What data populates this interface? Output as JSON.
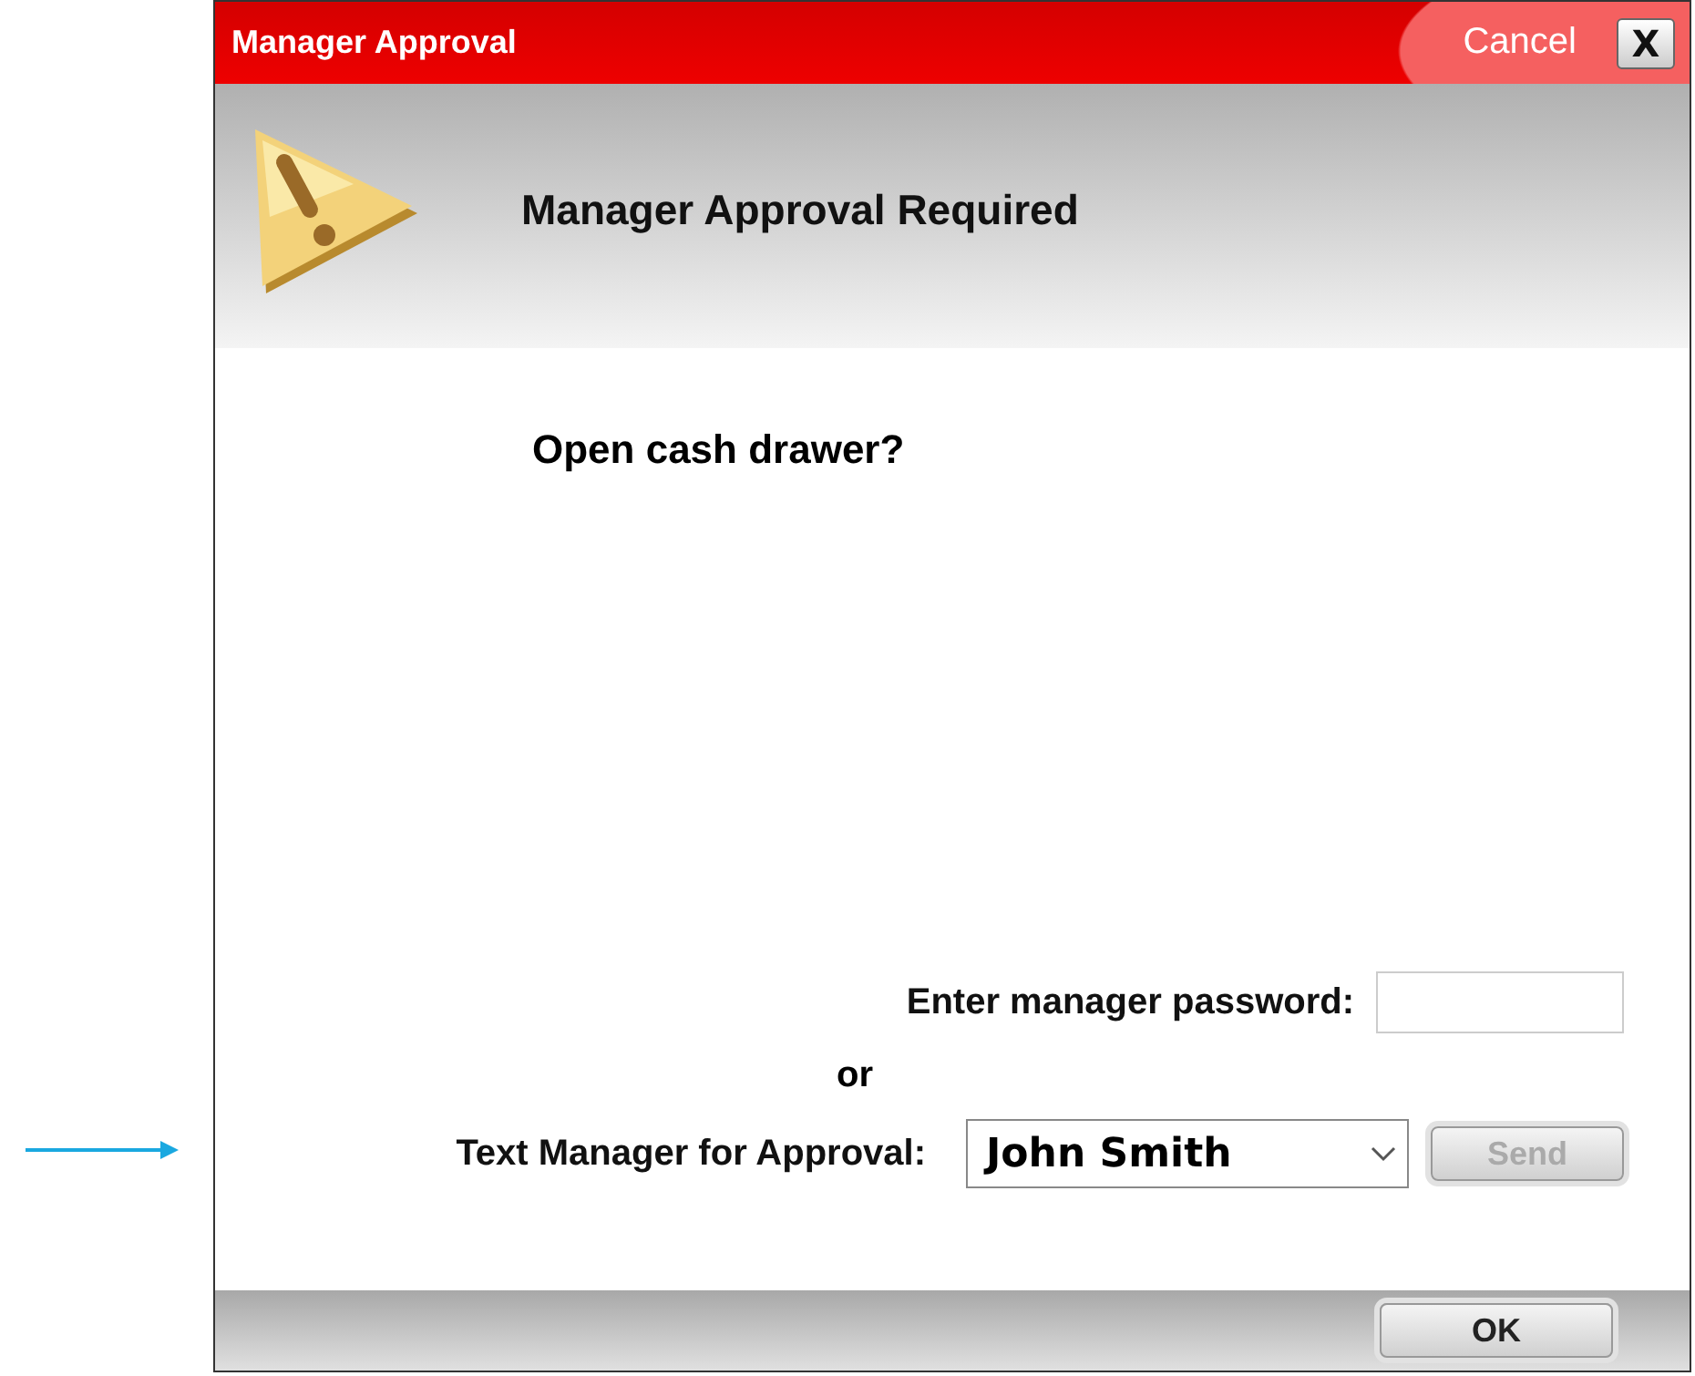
{
  "window": {
    "title": "Manager Approval",
    "cancel_label": "Cancel",
    "close_glyph": "X"
  },
  "header": {
    "title": "Manager Approval Required"
  },
  "message": "Open cash drawer?",
  "password": {
    "label": "Enter manager password:"
  },
  "separator": "or",
  "text_manager": {
    "label": "Text Manager for Approval:",
    "value": "John Smith"
  },
  "send_button": {
    "label": "Send",
    "disabled": true
  },
  "ok_button": {
    "label": "OK",
    "disabled": false
  },
  "annotation": {
    "kind": "arrow"
  }
}
